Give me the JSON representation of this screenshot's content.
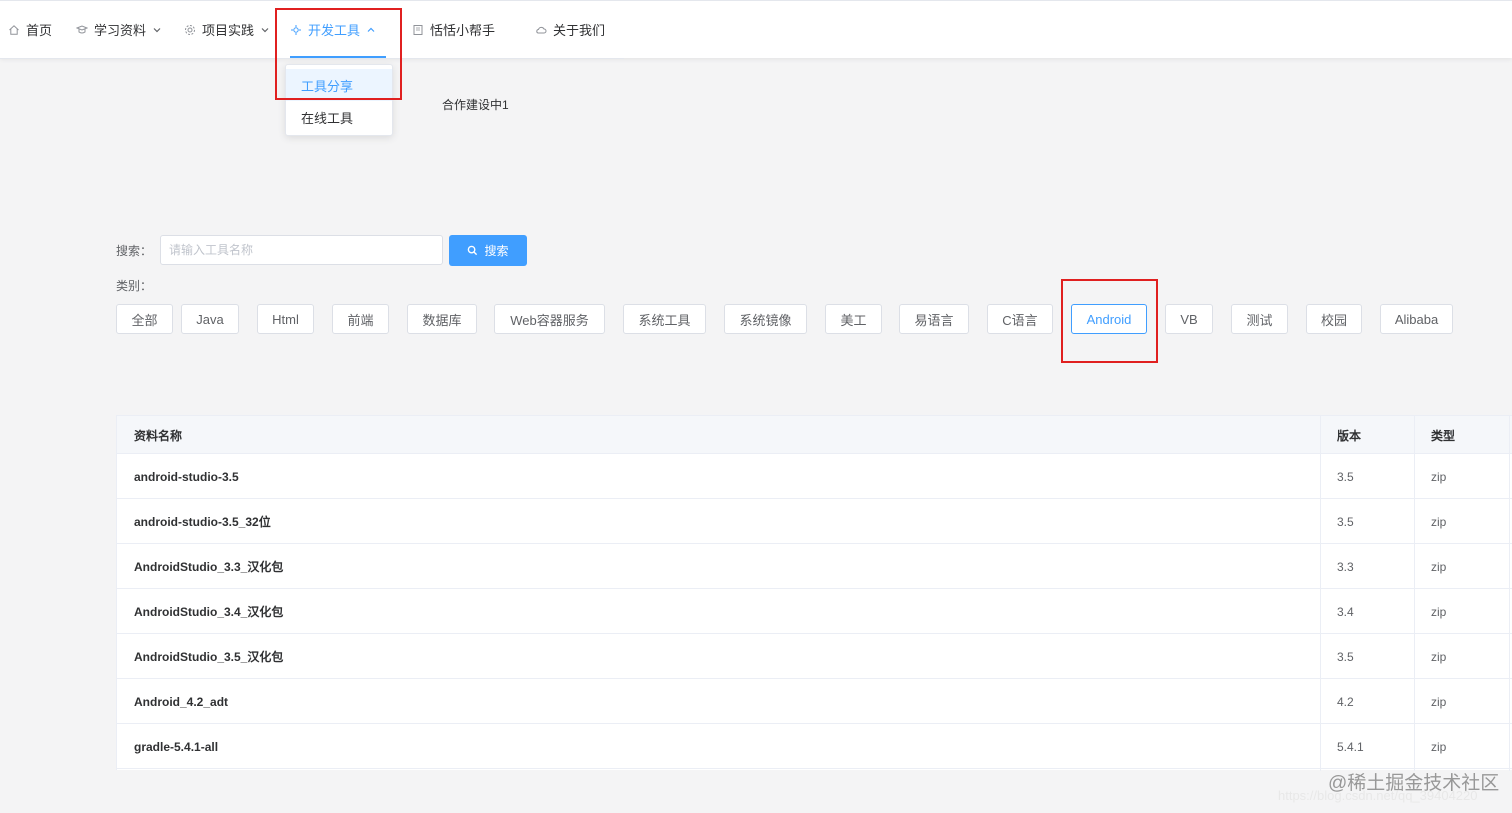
{
  "nav": {
    "items": [
      {
        "label": "首页",
        "icon": "home-icon"
      },
      {
        "label": "学习资料",
        "icon": "book-icon"
      },
      {
        "label": "项目实践",
        "icon": "gear-icon"
      },
      {
        "label": "开发工具",
        "icon": "tools-icon"
      },
      {
        "label": "恬恬小帮手",
        "icon": "notebook-icon"
      },
      {
        "label": "关于我们",
        "icon": "cloud-icon"
      }
    ],
    "active": "开发工具",
    "active_color": "#409eff"
  },
  "dropdown": {
    "items": [
      "工具分享",
      "在线工具"
    ],
    "active": "工具分享"
  },
  "construction_text": "合作建设中1",
  "search": {
    "label": "搜索：",
    "placeholder": "请输入工具名称",
    "button_label": "搜索"
  },
  "category": {
    "label": "类别：",
    "items": [
      "全部",
      "Java",
      "Html",
      "前端",
      "数据库",
      "Web容器服务",
      "系统工具",
      "系统镜像",
      "美工",
      "易语言",
      "C语言",
      "Android",
      "VB",
      "测试",
      "校园",
      "Alibaba"
    ],
    "active": "Android"
  },
  "table": {
    "columns": [
      "资料名称",
      "版本",
      "类型"
    ],
    "rows": [
      [
        "android-studio-3.5",
        "3.5",
        "zip"
      ],
      [
        "android-studio-3.5_32位",
        "3.5",
        "zip"
      ],
      [
        "AndroidStudio_3.3_汉化包",
        "3.3",
        "zip"
      ],
      [
        "AndroidStudio_3.4_汉化包",
        "3.4",
        "zip"
      ],
      [
        "AndroidStudio_3.5_汉化包",
        "3.5",
        "zip"
      ],
      [
        "Android_4.2_adt",
        "4.2",
        "zip"
      ],
      [
        "gradle-5.4.1-all",
        "5.4.1",
        "zip"
      ]
    ]
  },
  "watermark": {
    "text": "@稀土掘金技术社区",
    "url": "https://blog.csdn.net/qq_39404220"
  },
  "colors": {
    "accent": "#409eff",
    "highlight_box": "#e02020"
  }
}
